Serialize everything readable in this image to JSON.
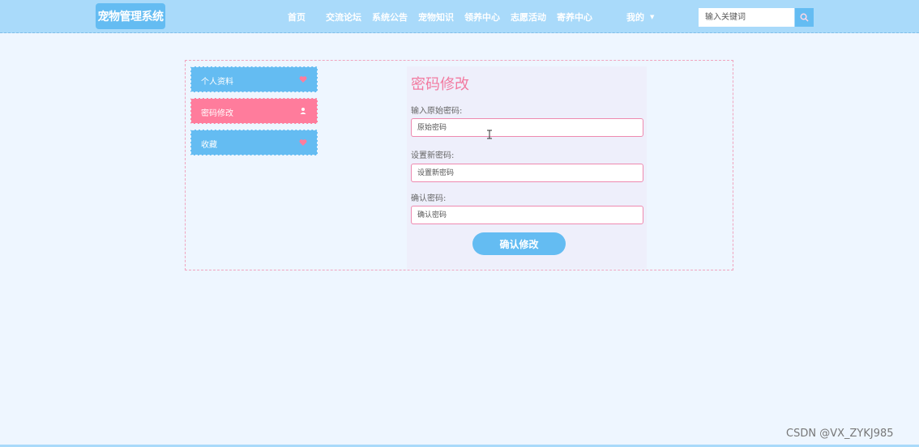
{
  "header": {
    "logo": "宠物管理系统",
    "nav": [
      "首页",
      "交流论坛",
      "系统公告",
      "宠物知识",
      "领养中心",
      "志愿活动",
      "寄养中心"
    ],
    "user_menu": "我的",
    "search_placeholder": "输入关键词"
  },
  "sidebar": {
    "items": [
      {
        "label": "个人资料",
        "icon": "heart-icon",
        "active": false
      },
      {
        "label": "密码修改",
        "icon": "user-icon",
        "active": true
      },
      {
        "label": "收藏",
        "icon": "heart-icon",
        "active": false
      }
    ]
  },
  "form": {
    "title": "密码修改",
    "fields": [
      {
        "label": "输入原始密码:",
        "placeholder": "原始密码"
      },
      {
        "label": "设置新密码:",
        "placeholder": "设置新密码"
      },
      {
        "label": "确认密码:",
        "placeholder": "确认密码"
      }
    ],
    "submit_label": "确认修改"
  },
  "watermark": "CSDN @VX_ZYKJ985",
  "colors": {
    "header_bg": "#a9dafa",
    "accent_blue": "#64bcf2",
    "accent_pink": "#ff7c9c",
    "title_pink": "#f27aa0"
  }
}
